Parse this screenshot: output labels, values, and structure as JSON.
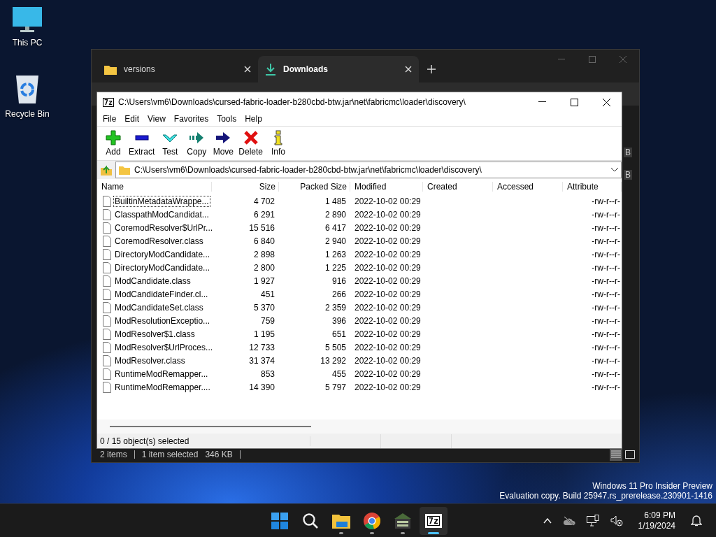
{
  "desktop_icons": [
    {
      "label": "This PC",
      "kind": "pc"
    },
    {
      "label": "Recycle Bin",
      "kind": "bin"
    }
  ],
  "explorer": {
    "tabs": [
      {
        "label": "versions",
        "kind": "folder",
        "selected": false
      },
      {
        "label": "Downloads",
        "kind": "download",
        "selected": true
      }
    ],
    "fragments": [
      "B",
      "B"
    ],
    "status_groups": [
      [
        "2 items"
      ],
      [
        "1 item selected",
        "346 KB"
      ]
    ],
    "view_buttons": [
      {
        "kind": "details",
        "selected": true
      },
      {
        "kind": "tiles",
        "selected": false
      }
    ]
  },
  "sevenzip": {
    "icon_text": "7z",
    "title": "C:\\Users\\vm6\\Downloads\\cursed-fabric-loader-b280cbd-btw.jar\\net\\fabricmc\\loader\\discovery\\",
    "menu": [
      "File",
      "Edit",
      "View",
      "Favorites",
      "Tools",
      "Help"
    ],
    "toolbar": [
      {
        "label": "Add",
        "kind": "add"
      },
      {
        "label": "Extract",
        "kind": "extract"
      },
      {
        "label": "Test",
        "kind": "test"
      },
      {
        "label": "Copy",
        "kind": "copy"
      },
      {
        "label": "Move",
        "kind": "move"
      },
      {
        "label": "Delete",
        "kind": "delete"
      },
      {
        "label": "Info",
        "kind": "info"
      }
    ],
    "address": "C:\\Users\\vm6\\Downloads\\cursed-fabric-loader-b280cbd-btw.jar\\net\\fabricmc\\loader\\discovery\\",
    "columns": [
      "Name",
      "Size",
      "Packed Size",
      "Modified",
      "Created",
      "Accessed",
      "Attribute"
    ],
    "rows": [
      {
        "name": "BuiltinMetadataWrappe...",
        "size": "4 702",
        "packed": "1 485",
        "modified": "2022-10-02 00:29",
        "attributes": "-rw-r--r-",
        "focused": true
      },
      {
        "name": "ClasspathModCandidat...",
        "size": "6 291",
        "packed": "2 890",
        "modified": "2022-10-02 00:29",
        "attributes": "-rw-r--r-",
        "focused": false
      },
      {
        "name": "CoremodResolver$UrlPr...",
        "size": "15 516",
        "packed": "6 417",
        "modified": "2022-10-02 00:29",
        "attributes": "-rw-r--r-",
        "focused": false
      },
      {
        "name": "CoremodResolver.class",
        "size": "6 840",
        "packed": "2 940",
        "modified": "2022-10-02 00:29",
        "attributes": "-rw-r--r-",
        "focused": false
      },
      {
        "name": "DirectoryModCandidate...",
        "size": "2 898",
        "packed": "1 263",
        "modified": "2022-10-02 00:29",
        "attributes": "-rw-r--r-",
        "focused": false
      },
      {
        "name": "DirectoryModCandidate...",
        "size": "2 800",
        "packed": "1 225",
        "modified": "2022-10-02 00:29",
        "attributes": "-rw-r--r-",
        "focused": false
      },
      {
        "name": "ModCandidate.class",
        "size": "1 927",
        "packed": "916",
        "modified": "2022-10-02 00:29",
        "attributes": "-rw-r--r-",
        "focused": false
      },
      {
        "name": "ModCandidateFinder.cl...",
        "size": "451",
        "packed": "266",
        "modified": "2022-10-02 00:29",
        "attributes": "-rw-r--r-",
        "focused": false
      },
      {
        "name": "ModCandidateSet.class",
        "size": "5 370",
        "packed": "2 359",
        "modified": "2022-10-02 00:29",
        "attributes": "-rw-r--r-",
        "focused": false
      },
      {
        "name": "ModResolutionExceptio...",
        "size": "759",
        "packed": "396",
        "modified": "2022-10-02 00:29",
        "attributes": "-rw-r--r-",
        "focused": false
      },
      {
        "name": "ModResolver$1.class",
        "size": "1 195",
        "packed": "651",
        "modified": "2022-10-02 00:29",
        "attributes": "-rw-r--r-",
        "focused": false
      },
      {
        "name": "ModResolver$UrlProces...",
        "size": "12 733",
        "packed": "5 505",
        "modified": "2022-10-02 00:29",
        "attributes": "-rw-r--r-",
        "focused": false
      },
      {
        "name": "ModResolver.class",
        "size": "31 374",
        "packed": "13 292",
        "modified": "2022-10-02 00:29",
        "attributes": "-rw-r--r-",
        "focused": false
      },
      {
        "name": "RuntimeModRemapper...",
        "size": "853",
        "packed": "455",
        "modified": "2022-10-02 00:29",
        "attributes": "-rw-r--r-",
        "focused": false
      },
      {
        "name": "RuntimeModRemapper....",
        "size": "14 390",
        "packed": "5 797",
        "modified": "2022-10-02 00:29",
        "attributes": "-rw-r--r-",
        "focused": false
      }
    ],
    "status": "0 / 15 object(s) selected"
  },
  "watermark": [
    "Windows 11 Pro Insider Preview",
    "Evaluation copy. Build 25947.rs_prerelease.230901-1416"
  ],
  "taskbar": {
    "apps": [
      {
        "kind": "start",
        "active": false
      },
      {
        "kind": "search",
        "active": false
      },
      {
        "kind": "folder",
        "running": true,
        "active": false
      },
      {
        "kind": "browser",
        "running": true,
        "active": false
      },
      {
        "kind": "game",
        "running": true,
        "active": false
      },
      {
        "kind": "sevenzip",
        "label": "7z",
        "running": true,
        "active": true
      }
    ],
    "time": "6:09 PM",
    "date": "1/19/2024"
  }
}
